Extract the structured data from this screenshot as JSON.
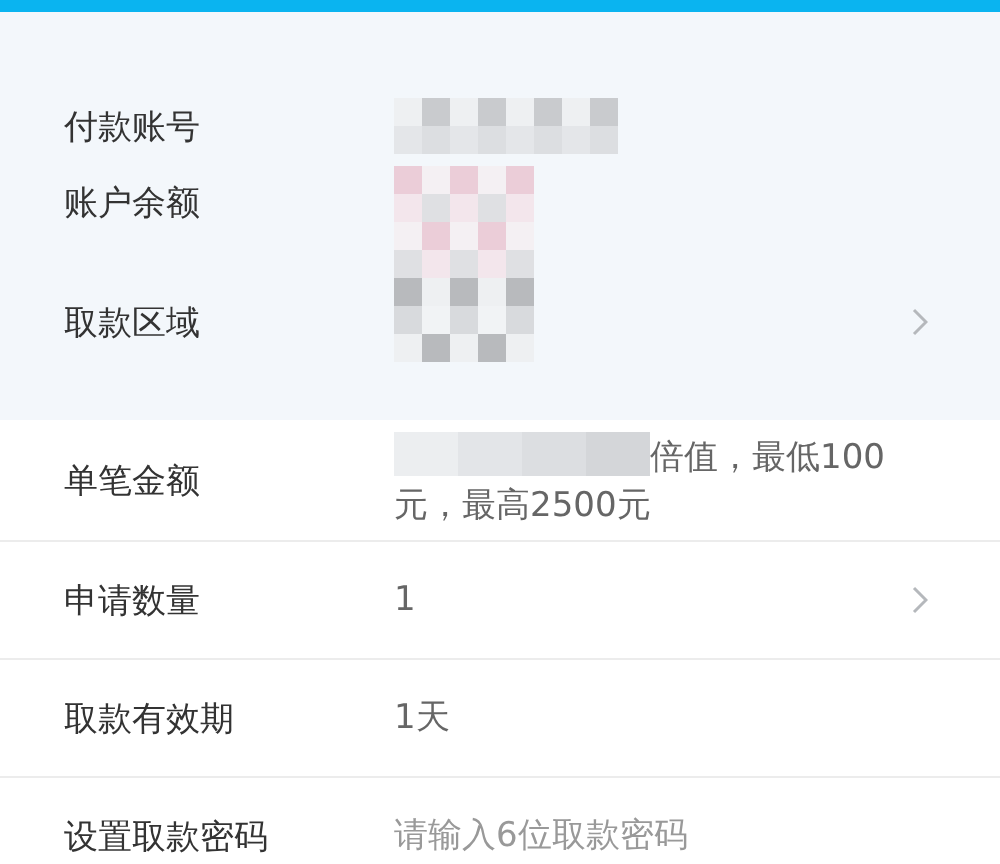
{
  "account_section": {
    "rows": [
      {
        "label": "付款账号",
        "redacted": true
      },
      {
        "label": "账户余额",
        "redacted": true
      },
      {
        "label": "取款区域",
        "redacted": true,
        "chevron": true
      }
    ]
  },
  "form_rows": [
    {
      "label": "单笔金额",
      "kind": "text",
      "redacted_prefix": true,
      "value": "倍值，最低100元，最高2500元"
    },
    {
      "label": "申请数量",
      "kind": "text",
      "value": "1",
      "chevron": true
    },
    {
      "label": "取款有效期",
      "kind": "text",
      "value": "1天"
    },
    {
      "label": "设置取款密码",
      "kind": "input",
      "placeholder": "请输入6位取款密码"
    }
  ]
}
